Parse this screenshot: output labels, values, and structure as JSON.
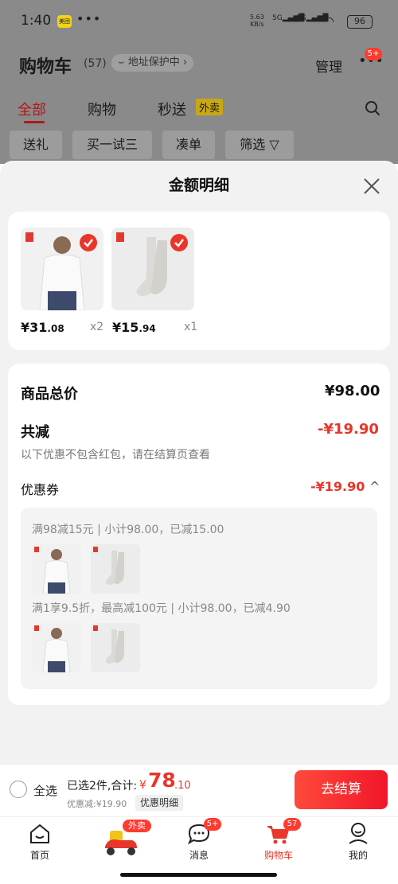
{
  "status_bar": {
    "time": "1:40",
    "app_badge": "美团",
    "dots": "•••",
    "net_speed": "5.63",
    "net_unit": "KB/s",
    "signal1": "5G",
    "signal2": "5G",
    "battery": "96"
  },
  "header": {
    "title": "购物车",
    "count": "(57)",
    "address": "地址保护中",
    "manage": "管理",
    "more_badge": "5+"
  },
  "tabs": [
    {
      "label": "全部"
    },
    {
      "label": "购物"
    },
    {
      "label": "秒送"
    }
  ],
  "waimai_tag": "外卖",
  "chips": [
    "送礼",
    "买一试三",
    "凑单",
    "筛选"
  ],
  "sheet": {
    "title": "金额明细",
    "products": [
      {
        "price_int": "¥31",
        "price_dec": ".08",
        "qty": "x2"
      },
      {
        "price_int": "¥15",
        "price_dec": ".94",
        "qty": "x1"
      }
    ],
    "total_label": "商品总价",
    "total_value": "¥98.00",
    "reduce_label": "共减",
    "reduce_value": "-¥19.90",
    "reduce_note": "以下优惠不包含红包，请在结算页查看",
    "coupon_label": "优惠券",
    "coupon_value": "-¥19.90",
    "promos": [
      {
        "text": "满98减15元 | 小计98.00，已减15.00"
      },
      {
        "text": "满1享9.5折，最高减100元 | 小计98.00，已减4.90"
      }
    ]
  },
  "checkout": {
    "select_all": "全选",
    "summary": "已选2件,合计:",
    "currency": "¥",
    "total_int": "78",
    "total_dec": ".10",
    "discount": "优惠减:¥19.90",
    "detail_btn": "优惠明细",
    "pay_button": "去结算"
  },
  "tabbar": {
    "items": [
      {
        "label": "首页"
      },
      {
        "label": ""
      },
      {
        "label": "消息"
      },
      {
        "label": "购物车"
      },
      {
        "label": "我的"
      }
    ],
    "waimai_badge": "外卖",
    "msg_badge": "5+",
    "cart_badge": "57"
  },
  "colors": {
    "accent": "#e8362b",
    "tab_active": "#b21818",
    "price_red": "#e8362b"
  }
}
